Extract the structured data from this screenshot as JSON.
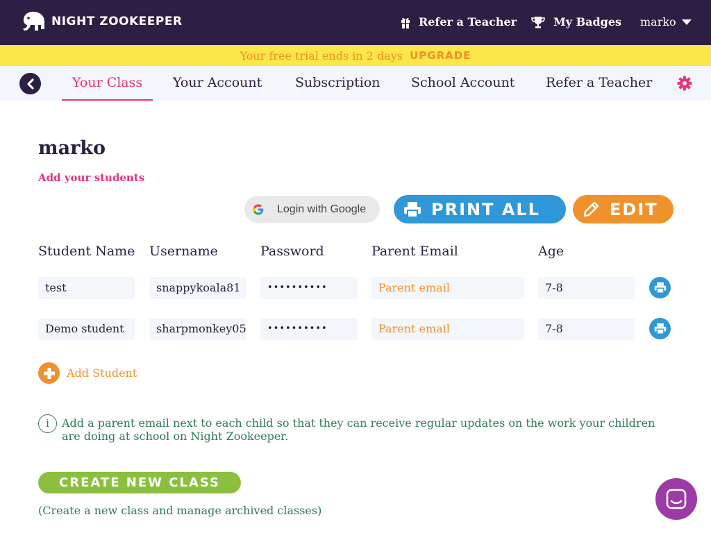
{
  "header": {
    "logo_text": "NIGHT ZOOKEEPER",
    "refer_label": "Refer a Teacher",
    "badges_label": "My Badges",
    "user_name": "marko"
  },
  "banner": {
    "message": "Your free trial ends in 2 days",
    "upgrade_label": "UPGRADE"
  },
  "tabs": [
    {
      "label": "Your Class",
      "active": true
    },
    {
      "label": "Your Account"
    },
    {
      "label": "Subscription"
    },
    {
      "label": "School Account"
    },
    {
      "label": "Refer a Teacher"
    }
  ],
  "class": {
    "title": "marko",
    "add_students_label": "Add your students"
  },
  "actions": {
    "google_label": "Login with Google",
    "print_all_label": "PRINT ALL",
    "edit_label": "EDIT"
  },
  "columns": [
    "Student Name",
    "Username",
    "Password",
    "Parent Email",
    "Age"
  ],
  "students": [
    {
      "name": "test",
      "username": "snappykoala81",
      "password": "••••••••••",
      "parent_email_placeholder": "Parent email",
      "age": "7-8"
    },
    {
      "name": "Demo student",
      "username": "sharpmonkey05",
      "password": "••••••••••",
      "parent_email_placeholder": "Parent email",
      "age": "7-8"
    }
  ],
  "add_student_label": "Add Student",
  "info_text": "Add a parent email next to each child so that they can receive regular updates on the work your children are doing at school on Night Zookeeper.",
  "create_class": {
    "label": "CREATE NEW CLASS",
    "note": "(Create a new class and manage archived classes)"
  },
  "colors": {
    "header_bg": "#2d1f44",
    "banner_bg": "#fbe74a",
    "accent_pink": "#e8317f",
    "accent_orange": "#f0922b",
    "accent_blue": "#2e98d8",
    "accent_green": "#8cbf3f",
    "chat_purple": "#9c3aa6"
  }
}
